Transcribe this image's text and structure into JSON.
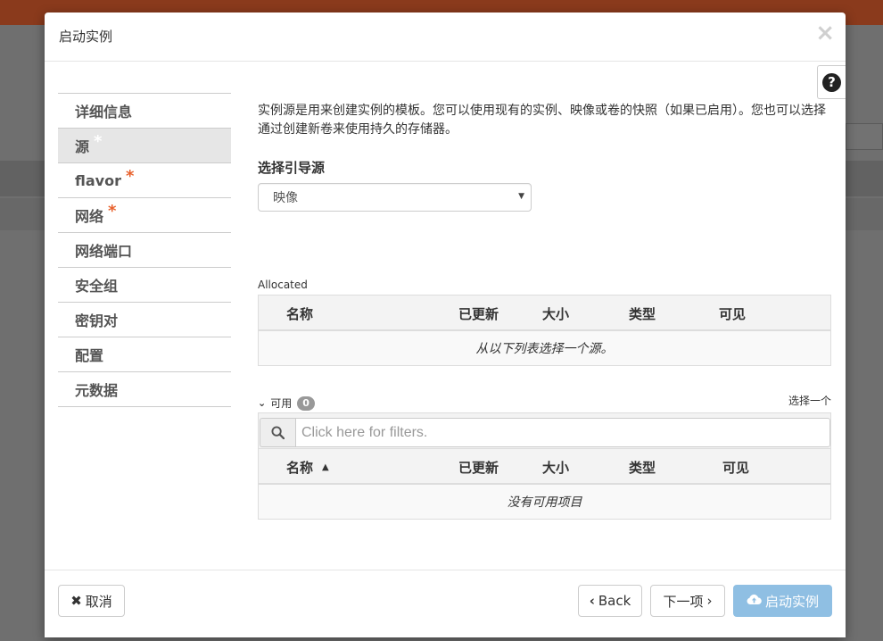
{
  "modal": {
    "title": "启动实例",
    "close_glyph": "×",
    "help_glyph": "?"
  },
  "sidebar": {
    "items": [
      {
        "label": "详细信息",
        "required": false,
        "active": false
      },
      {
        "label": "源",
        "required": true,
        "active": true
      },
      {
        "label": "flavor",
        "required": true,
        "active": false
      },
      {
        "label": "网络",
        "required": true,
        "active": false
      },
      {
        "label": "网络端口",
        "required": false,
        "active": false
      },
      {
        "label": "安全组",
        "required": false,
        "active": false
      },
      {
        "label": "密钥对",
        "required": false,
        "active": false
      },
      {
        "label": "配置",
        "required": false,
        "active": false
      },
      {
        "label": "元数据",
        "required": false,
        "active": false
      }
    ],
    "required_marker": "*"
  },
  "main": {
    "description": "实例源是用来创建实例的模板。您可以使用现有的实例、映像或卷的快照（如果已启用）。您也可以选择通过创建新卷来使用持久的存储器。",
    "boot_source_label": "选择引导源",
    "boot_source_value": "映像",
    "allocated": {
      "label": "Allocated",
      "columns": [
        "名称",
        "已更新",
        "大小",
        "类型",
        "可见"
      ],
      "empty_text": "从以下列表选择一个源。"
    },
    "available": {
      "label": "可用",
      "count": "0",
      "select_one": "选择一个",
      "filter_placeholder": "Click here for filters.",
      "columns": [
        "名称",
        "已更新",
        "大小",
        "类型",
        "可见"
      ],
      "empty_text": "没有可用项目"
    }
  },
  "footer": {
    "cancel_label": "取消",
    "back_label": "Back",
    "next_label": "下一项",
    "launch_label": "启动实例"
  },
  "colors": {
    "required": "#e8612c",
    "launch_button": "#8fbfe3",
    "top_bar": "#8a3a1c"
  }
}
